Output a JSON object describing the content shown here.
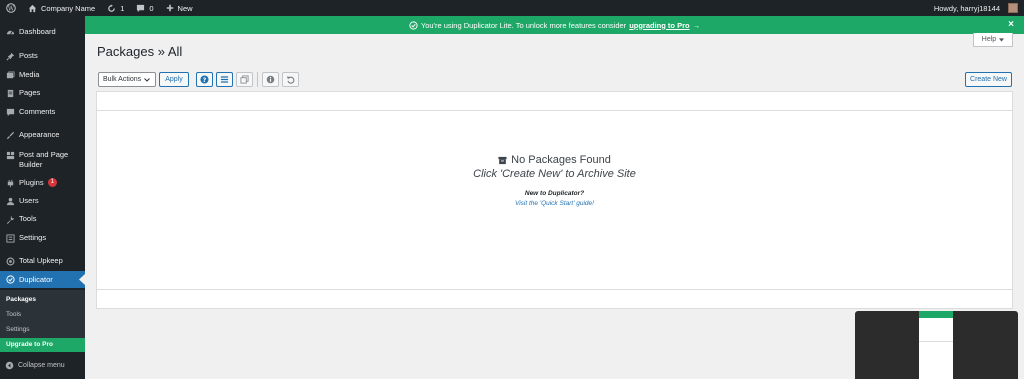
{
  "adminbar": {
    "site_name": "Company Name",
    "updates_count": "1",
    "comments_count": "0",
    "new_label": "New",
    "greeting": "Howdy, harryj18144"
  },
  "sidebar": {
    "items": [
      {
        "label": "Dashboard",
        "icon": "dashboard-icon"
      },
      {
        "label": "Posts",
        "icon": "pin-icon"
      },
      {
        "label": "Media",
        "icon": "media-icon"
      },
      {
        "label": "Pages",
        "icon": "pages-icon"
      },
      {
        "label": "Comments",
        "icon": "comment-icon"
      },
      {
        "label": "Appearance",
        "icon": "brush-icon"
      },
      {
        "label": "Post and Page Builder",
        "icon": "builder-icon"
      },
      {
        "label": "Plugins",
        "icon": "plugin-icon",
        "badge": "1"
      },
      {
        "label": "Users",
        "icon": "users-icon"
      },
      {
        "label": "Tools",
        "icon": "wrench-icon"
      },
      {
        "label": "Settings",
        "icon": "settings-icon"
      },
      {
        "label": "Total Upkeep",
        "icon": "upkeep-icon"
      },
      {
        "label": "Duplicator",
        "icon": "duplicator-icon"
      }
    ],
    "submenu": [
      "Packages",
      "Tools",
      "Settings"
    ],
    "upgrade_label": "Upgrade to Pro",
    "collapse_label": "Collapse menu"
  },
  "notice": {
    "text": "You're using Duplicator Lite. To unlock more features consider",
    "link": "upgrading to Pro",
    "arrow": "→",
    "close": "×"
  },
  "help_label": "Help",
  "page_title": "Packages » All",
  "toolbar": {
    "bulk_actions": "Bulk Actions",
    "apply": "Apply",
    "create_new": "Create New"
  },
  "empty_state": {
    "title": "No Packages Found",
    "subtitle": "Click 'Create New' to Archive Site",
    "new_to": "New to Duplicator?",
    "guide_link": "Visit the 'Quick Start' guide!"
  },
  "colors": {
    "accent_green": "#1da867",
    "admin_dark": "#1d2327",
    "link_blue": "#2271b1"
  }
}
